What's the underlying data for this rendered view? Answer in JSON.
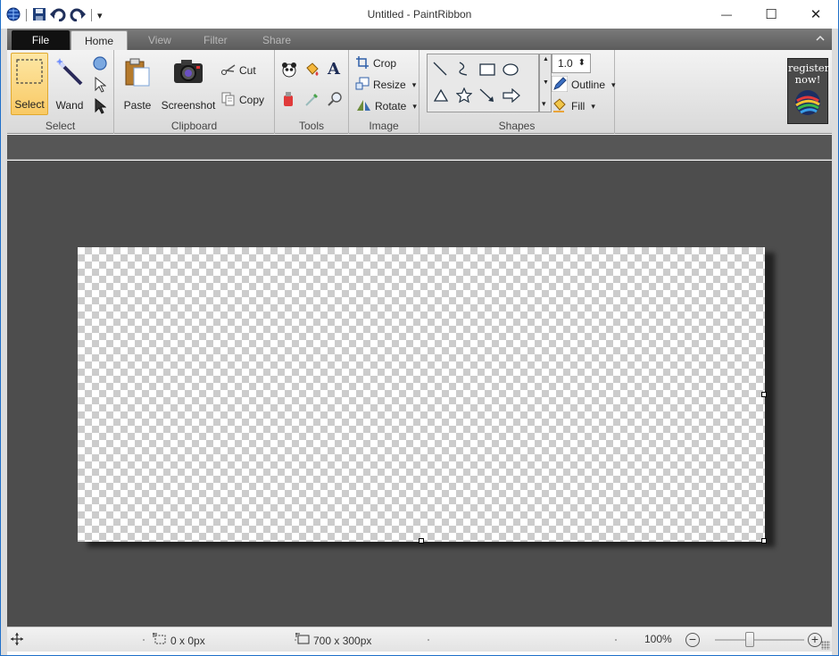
{
  "window": {
    "title": "Untitled - PaintRibbon",
    "minimize_glyph": "—",
    "maximize_glyph": "☐",
    "close_glyph": "✕"
  },
  "quick_access": {
    "dropdown_glyph": "▾"
  },
  "tabs": {
    "file": "File",
    "home": "Home",
    "view": "View",
    "filter": "Filter",
    "share": "Share"
  },
  "ribbon": {
    "select_group": {
      "label": "Select",
      "select_label": "Select",
      "wand_label": "Wand"
    },
    "clipboard_group": {
      "label": "Clipboard",
      "paste_label": "Paste",
      "screenshot_label": "Screenshot",
      "cut_label": "Cut",
      "copy_label": "Copy"
    },
    "tools_group": {
      "label": "Tools",
      "text_tool_glyph": "A"
    },
    "image_group": {
      "label": "Image",
      "crop_label": "Crop",
      "resize_label": "Resize",
      "rotate_label": "Rotate"
    },
    "shapes_group": {
      "label": "Shapes",
      "stroke_width": "1.0",
      "outline_label": "Outline",
      "fill_label": "Fill"
    },
    "register": {
      "line1": "register",
      "line2": "now!"
    }
  },
  "status": {
    "selection_size": "0 x 0px",
    "image_size": "700 x 300px",
    "zoom": "100%",
    "zoom_out_glyph": "−",
    "zoom_in_glyph": "+"
  },
  "colors": {
    "accent_blue": "#1e6fc9",
    "select_highlight": "#f9c964",
    "workspace": "#4d4d4d"
  }
}
